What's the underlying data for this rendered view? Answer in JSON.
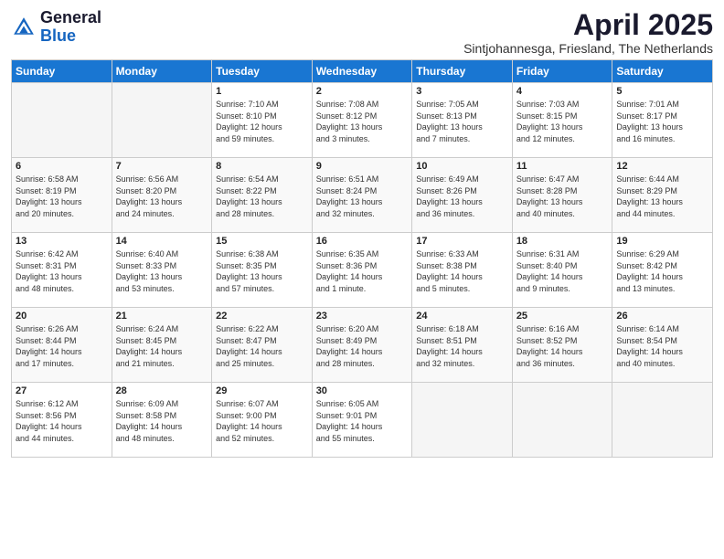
{
  "logo": {
    "general": "General",
    "blue": "Blue"
  },
  "title": "April 2025",
  "location": "Sintjohannesga, Friesland, The Netherlands",
  "days_of_week": [
    "Sunday",
    "Monday",
    "Tuesday",
    "Wednesday",
    "Thursday",
    "Friday",
    "Saturday"
  ],
  "weeks": [
    [
      {
        "day": "",
        "info": ""
      },
      {
        "day": "",
        "info": ""
      },
      {
        "day": "1",
        "info": "Sunrise: 7:10 AM\nSunset: 8:10 PM\nDaylight: 12 hours\nand 59 minutes."
      },
      {
        "day": "2",
        "info": "Sunrise: 7:08 AM\nSunset: 8:12 PM\nDaylight: 13 hours\nand 3 minutes."
      },
      {
        "day": "3",
        "info": "Sunrise: 7:05 AM\nSunset: 8:13 PM\nDaylight: 13 hours\nand 7 minutes."
      },
      {
        "day": "4",
        "info": "Sunrise: 7:03 AM\nSunset: 8:15 PM\nDaylight: 13 hours\nand 12 minutes."
      },
      {
        "day": "5",
        "info": "Sunrise: 7:01 AM\nSunset: 8:17 PM\nDaylight: 13 hours\nand 16 minutes."
      }
    ],
    [
      {
        "day": "6",
        "info": "Sunrise: 6:58 AM\nSunset: 8:19 PM\nDaylight: 13 hours\nand 20 minutes."
      },
      {
        "day": "7",
        "info": "Sunrise: 6:56 AM\nSunset: 8:20 PM\nDaylight: 13 hours\nand 24 minutes."
      },
      {
        "day": "8",
        "info": "Sunrise: 6:54 AM\nSunset: 8:22 PM\nDaylight: 13 hours\nand 28 minutes."
      },
      {
        "day": "9",
        "info": "Sunrise: 6:51 AM\nSunset: 8:24 PM\nDaylight: 13 hours\nand 32 minutes."
      },
      {
        "day": "10",
        "info": "Sunrise: 6:49 AM\nSunset: 8:26 PM\nDaylight: 13 hours\nand 36 minutes."
      },
      {
        "day": "11",
        "info": "Sunrise: 6:47 AM\nSunset: 8:28 PM\nDaylight: 13 hours\nand 40 minutes."
      },
      {
        "day": "12",
        "info": "Sunrise: 6:44 AM\nSunset: 8:29 PM\nDaylight: 13 hours\nand 44 minutes."
      }
    ],
    [
      {
        "day": "13",
        "info": "Sunrise: 6:42 AM\nSunset: 8:31 PM\nDaylight: 13 hours\nand 48 minutes."
      },
      {
        "day": "14",
        "info": "Sunrise: 6:40 AM\nSunset: 8:33 PM\nDaylight: 13 hours\nand 53 minutes."
      },
      {
        "day": "15",
        "info": "Sunrise: 6:38 AM\nSunset: 8:35 PM\nDaylight: 13 hours\nand 57 minutes."
      },
      {
        "day": "16",
        "info": "Sunrise: 6:35 AM\nSunset: 8:36 PM\nDaylight: 14 hours\nand 1 minute."
      },
      {
        "day": "17",
        "info": "Sunrise: 6:33 AM\nSunset: 8:38 PM\nDaylight: 14 hours\nand 5 minutes."
      },
      {
        "day": "18",
        "info": "Sunrise: 6:31 AM\nSunset: 8:40 PM\nDaylight: 14 hours\nand 9 minutes."
      },
      {
        "day": "19",
        "info": "Sunrise: 6:29 AM\nSunset: 8:42 PM\nDaylight: 14 hours\nand 13 minutes."
      }
    ],
    [
      {
        "day": "20",
        "info": "Sunrise: 6:26 AM\nSunset: 8:44 PM\nDaylight: 14 hours\nand 17 minutes."
      },
      {
        "day": "21",
        "info": "Sunrise: 6:24 AM\nSunset: 8:45 PM\nDaylight: 14 hours\nand 21 minutes."
      },
      {
        "day": "22",
        "info": "Sunrise: 6:22 AM\nSunset: 8:47 PM\nDaylight: 14 hours\nand 25 minutes."
      },
      {
        "day": "23",
        "info": "Sunrise: 6:20 AM\nSunset: 8:49 PM\nDaylight: 14 hours\nand 28 minutes."
      },
      {
        "day": "24",
        "info": "Sunrise: 6:18 AM\nSunset: 8:51 PM\nDaylight: 14 hours\nand 32 minutes."
      },
      {
        "day": "25",
        "info": "Sunrise: 6:16 AM\nSunset: 8:52 PM\nDaylight: 14 hours\nand 36 minutes."
      },
      {
        "day": "26",
        "info": "Sunrise: 6:14 AM\nSunset: 8:54 PM\nDaylight: 14 hours\nand 40 minutes."
      }
    ],
    [
      {
        "day": "27",
        "info": "Sunrise: 6:12 AM\nSunset: 8:56 PM\nDaylight: 14 hours\nand 44 minutes."
      },
      {
        "day": "28",
        "info": "Sunrise: 6:09 AM\nSunset: 8:58 PM\nDaylight: 14 hours\nand 48 minutes."
      },
      {
        "day": "29",
        "info": "Sunrise: 6:07 AM\nSunset: 9:00 PM\nDaylight: 14 hours\nand 52 minutes."
      },
      {
        "day": "30",
        "info": "Sunrise: 6:05 AM\nSunset: 9:01 PM\nDaylight: 14 hours\nand 55 minutes."
      },
      {
        "day": "",
        "info": ""
      },
      {
        "day": "",
        "info": ""
      },
      {
        "day": "",
        "info": ""
      }
    ]
  ]
}
